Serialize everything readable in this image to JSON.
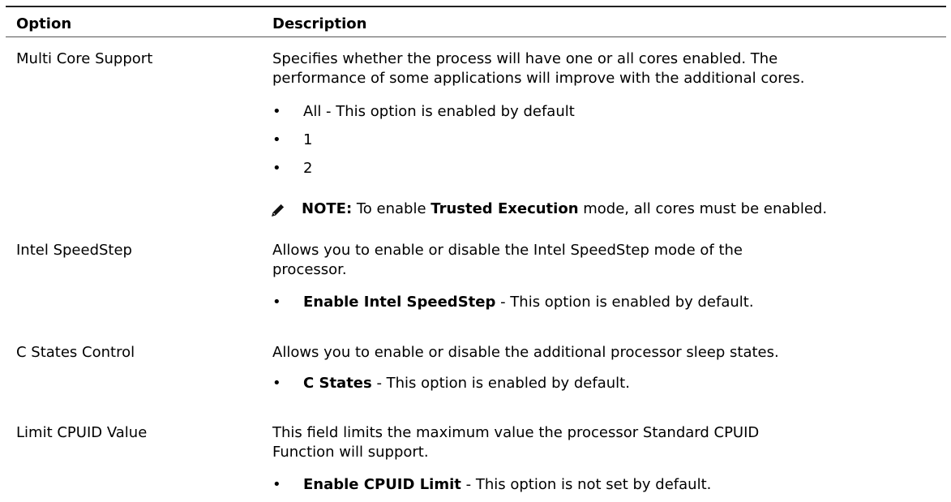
{
  "table": {
    "header": {
      "option": "Option",
      "description": "Description"
    },
    "rows": [
      {
        "option": "Multi Core Support",
        "description_lines": [
          "Specifies whether the process will have one or all cores enabled. The",
          "performance of some applications will improve with the additional cores."
        ],
        "bullets": [
          {
            "bold": "",
            "text": "All - This option is enabled by default"
          },
          {
            "bold": "",
            "text": "1"
          },
          {
            "bold": "",
            "text": "2"
          }
        ],
        "note": {
          "icon": "pencil-note-icon",
          "label": "NOTE:",
          "pre": " To enable ",
          "bold": "Trusted Execution",
          "post": " mode, all cores must be enabled."
        }
      },
      {
        "option": "Intel SpeedStep",
        "description_lines": [
          "Allows you to enable or disable the Intel SpeedStep mode of the",
          "processor."
        ],
        "bullets": [
          {
            "bold": "Enable Intel SpeedStep",
            "text": " - This option is enabled by default."
          }
        ]
      },
      {
        "option": "C States Control",
        "description_lines": [
          "Allows you to enable or disable the additional processor sleep states."
        ],
        "bullets": [
          {
            "bold": "C States",
            "text": " - This option is enabled by default."
          }
        ]
      },
      {
        "option": "Limit CPUID Value",
        "description_lines": [
          "This field limits the maximum value the processor Standard CPUID",
          "Function will support."
        ],
        "bullets": [
          {
            "bold": "Enable CPUID Limit",
            "text": " - This option is not set by default."
          }
        ]
      }
    ]
  },
  "bullet_char": "•"
}
